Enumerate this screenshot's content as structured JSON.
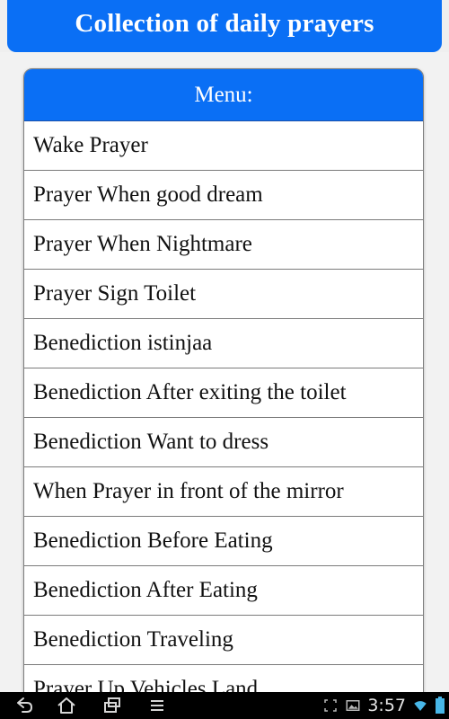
{
  "app": {
    "title": "Collection of daily prayers"
  },
  "menu": {
    "header": "Menu:",
    "items": [
      "Wake Prayer",
      "Prayer When good dream",
      "Prayer When Nightmare",
      "Prayer Sign Toilet",
      "Benediction istinjaa",
      "Benediction After exiting the toilet",
      "Benediction Want to dress",
      "When Prayer in front of the mirror",
      "Benediction Before Eating",
      "Benediction After Eating",
      "Benediction Traveling",
      "Prayer Up Vehicles Land"
    ]
  },
  "system_bar": {
    "time": "3:57",
    "icons": [
      "back-icon",
      "home-icon",
      "recent-apps-icon",
      "menu-icon",
      "screenshot-icon",
      "gallery-icon",
      "wifi-icon",
      "battery-icon"
    ]
  },
  "colors": {
    "accent": "#0a6ff5",
    "header_text": "#ffffff",
    "system_bar": "#000000"
  }
}
